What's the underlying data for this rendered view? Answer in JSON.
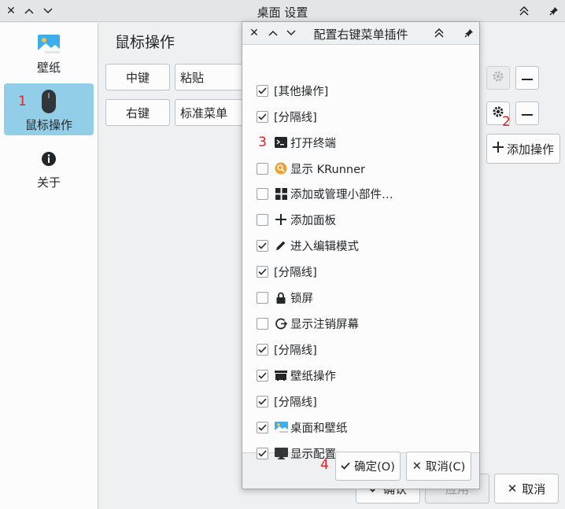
{
  "window": {
    "title": "桌面 设置"
  },
  "sidebar": {
    "items": [
      {
        "label": "壁纸",
        "icon": "wallpaper-icon"
      },
      {
        "label": "鼠标操作",
        "icon": "mouse-icon",
        "active": true
      },
      {
        "label": "关于",
        "icon": "info-icon"
      }
    ]
  },
  "main": {
    "title": "鼠标操作",
    "rows": [
      {
        "button": "中键",
        "plugin": "粘贴"
      },
      {
        "button": "右键",
        "plugin": "标准菜单"
      }
    ],
    "add_label": "添加操作",
    "ok_label": "确认",
    "apply_label": "应用",
    "cancel_label": "取消"
  },
  "annotations": [
    "1",
    "2",
    "3",
    "4"
  ],
  "dialog": {
    "title": "配置右键菜单插件",
    "items": [
      {
        "label": "[其他操作]",
        "checked": true,
        "icon": ""
      },
      {
        "label": "[分隔线]",
        "checked": true,
        "icon": ""
      },
      {
        "label": "打开终端",
        "checked": null,
        "icon": "terminal-icon"
      },
      {
        "label": "显示 KRunner",
        "checked": false,
        "icon": "krunner-icon"
      },
      {
        "label": "添加或管理小部件…",
        "checked": false,
        "icon": "widgets-icon"
      },
      {
        "label": "添加面板",
        "checked": false,
        "icon": "plus-icon"
      },
      {
        "label": "进入编辑模式",
        "checked": true,
        "icon": "pencil-icon"
      },
      {
        "label": "[分隔线]",
        "checked": true,
        "icon": ""
      },
      {
        "label": "锁屏",
        "checked": false,
        "icon": "lock-icon"
      },
      {
        "label": "显示注销屏幕",
        "checked": false,
        "icon": "logout-icon"
      },
      {
        "label": "[分隔线]",
        "checked": true,
        "icon": ""
      },
      {
        "label": "壁纸操作",
        "checked": true,
        "icon": "wallpaper-action-icon"
      },
      {
        "label": "[分隔线]",
        "checked": true,
        "icon": ""
      },
      {
        "label": "桌面和壁纸",
        "checked": true,
        "icon": "desktop-wallpaper-icon"
      },
      {
        "label": "显示配置",
        "checked": true,
        "icon": "display-icon"
      }
    ],
    "ok_label": "确定(O)",
    "cancel_label": "取消(C)"
  },
  "colors": {
    "accent": "#3daee9",
    "sidebar_active": "#93cee9",
    "annotation": "#e8202a"
  }
}
